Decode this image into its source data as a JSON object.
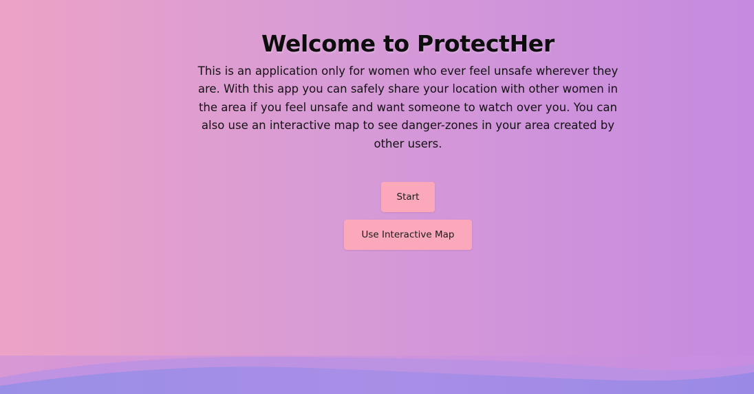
{
  "hero": {
    "title": "Welcome to ProtectHer",
    "description": "This is an application only for women who ever feel unsafe wherever they are. With this app you can safely share your location with other women in the area if you feel unsafe and want someone to watch over you. You can also use an interactive map to see danger-zones in your area created by other users."
  },
  "actions": {
    "start_label": "Start",
    "map_label": "Use Interactive Map"
  },
  "colors": {
    "background_left": "#eca2c6",
    "background_right": "#c68ae0",
    "button": "#fba8bb",
    "wave": "#9189e8"
  }
}
